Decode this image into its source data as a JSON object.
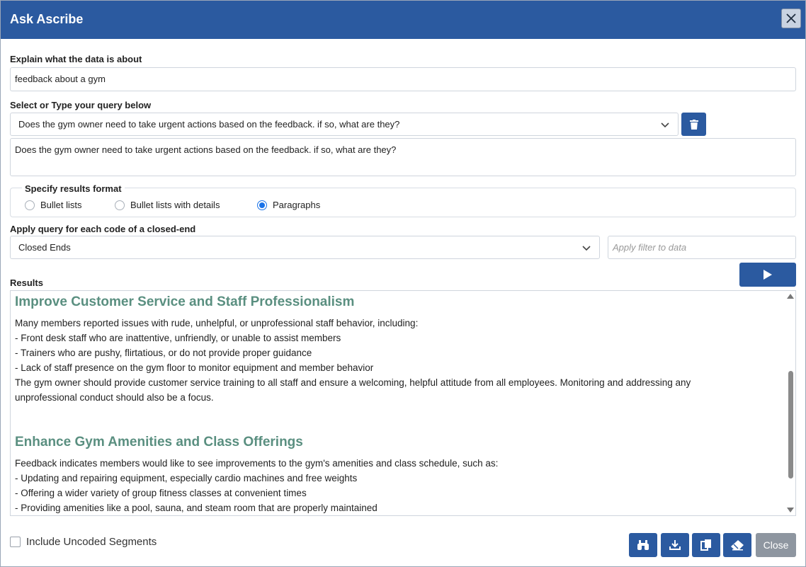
{
  "dialog": {
    "title": "Ask Ascribe"
  },
  "context": {
    "label": "Explain what the data is about",
    "value": "feedback about a gym"
  },
  "query": {
    "label": "Select or Type your query below",
    "selected": "Does the gym owner need to take urgent actions based on the feedback. if so, what are they?",
    "text": "Does the gym owner need to take urgent actions based on the feedback. if so, what are they?"
  },
  "format": {
    "legend": "Specify results format",
    "options": [
      "Bullet lists",
      "Bullet lists with details",
      "Paragraphs"
    ],
    "selected": "Paragraphs"
  },
  "closed_end": {
    "label": "Apply query for each code of a closed-end",
    "selected": "Closed Ends",
    "filter_placeholder": "Apply filter to data"
  },
  "results": {
    "label": "Results",
    "sections": [
      {
        "heading": "Improve Customer Service and Staff Professionalism",
        "lines": [
          "Many members reported issues with rude, unhelpful, or unprofessional staff behavior, including:",
          "- Front desk staff who are inattentive, unfriendly, or unable to assist members",
          "- Trainers who are pushy, flirtatious, or do not provide proper guidance",
          "- Lack of staff presence on the gym floor to monitor equipment and member behavior",
          "The gym owner should provide customer service training to all staff and ensure a welcoming, helpful attitude from all employees. Monitoring and addressing any",
          "unprofessional conduct should also be a focus."
        ]
      },
      {
        "heading": "Enhance Gym Amenities and Class Offerings",
        "lines": [
          "Feedback indicates members would like to see improvements to the gym's amenities and class schedule, such as:",
          "- Updating and repairing equipment, especially cardio machines and free weights",
          "- Offering a wider variety of group fitness classes at convenient times",
          "- Providing amenities like a pool, sauna, and steam room that are properly maintained"
        ]
      }
    ]
  },
  "footer": {
    "include_uncoded_label": "Include Uncoded Segments",
    "close_label": "Close"
  },
  "colors": {
    "accent": "#2b5aa0",
    "heading_green": "#5a8f80",
    "close_gray": "#8e96a0"
  }
}
